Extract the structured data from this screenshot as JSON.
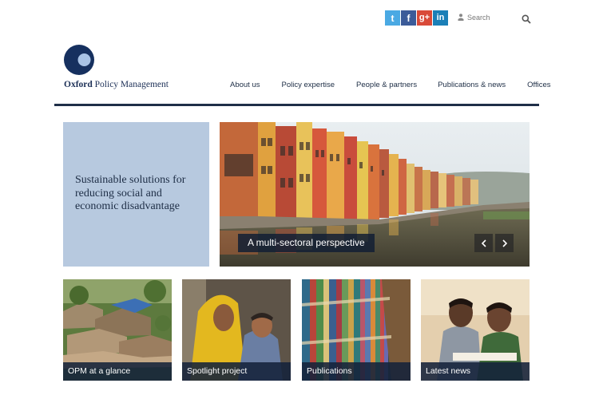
{
  "social": {
    "twitter": "t",
    "facebook": "f",
    "googleplus": "g+",
    "linkedin": "in"
  },
  "header": {
    "search_label": "Search"
  },
  "logo": {
    "bold": "Oxford",
    "rest": " Policy Management"
  },
  "nav": [
    "About us",
    "Policy expertise",
    "People & partners",
    "Publications & news",
    "Offices"
  ],
  "hero": {
    "tagline": "Sustainable solutions for reducing social and economic disadvantage",
    "caption": "A multi-sectoral perspective"
  },
  "tiles": [
    "OPM at a glance",
    "Spotlight project",
    "Publications",
    "Latest news"
  ],
  "colors": {
    "navy": "#1f2f48",
    "tagline_bg": "#b7c9df",
    "twitter": "#4aa9e3",
    "facebook": "#3b5b99",
    "googleplus": "#d94a38",
    "linkedin": "#1b7fb7"
  }
}
